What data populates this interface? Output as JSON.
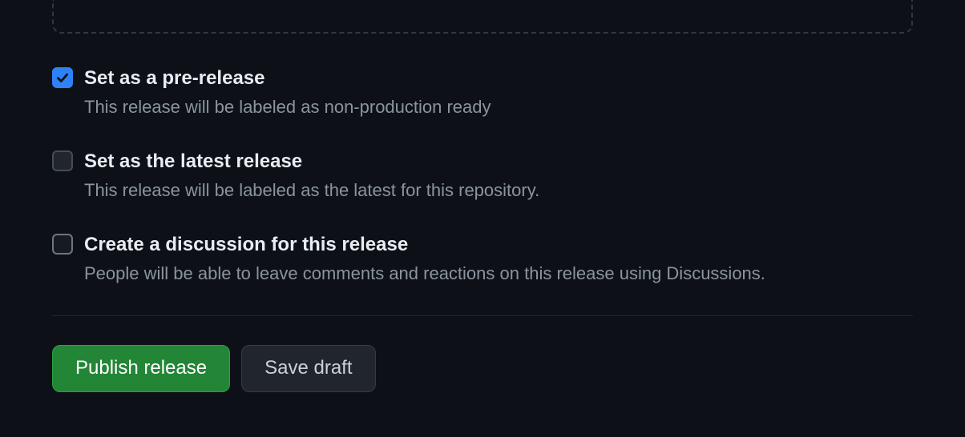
{
  "options": {
    "prerelease": {
      "label": "Set as a pre-release",
      "description": "This release will be labeled as non-production ready",
      "checked": true
    },
    "latest": {
      "label": "Set as the latest release",
      "description": "This release will be labeled as the latest for this repository.",
      "checked": false
    },
    "discussion": {
      "label": "Create a discussion for this release",
      "description": "People will be able to leave comments and reactions on this release using Discussions.",
      "checked": false
    }
  },
  "actions": {
    "publish_label": "Publish release",
    "save_draft_label": "Save draft"
  }
}
